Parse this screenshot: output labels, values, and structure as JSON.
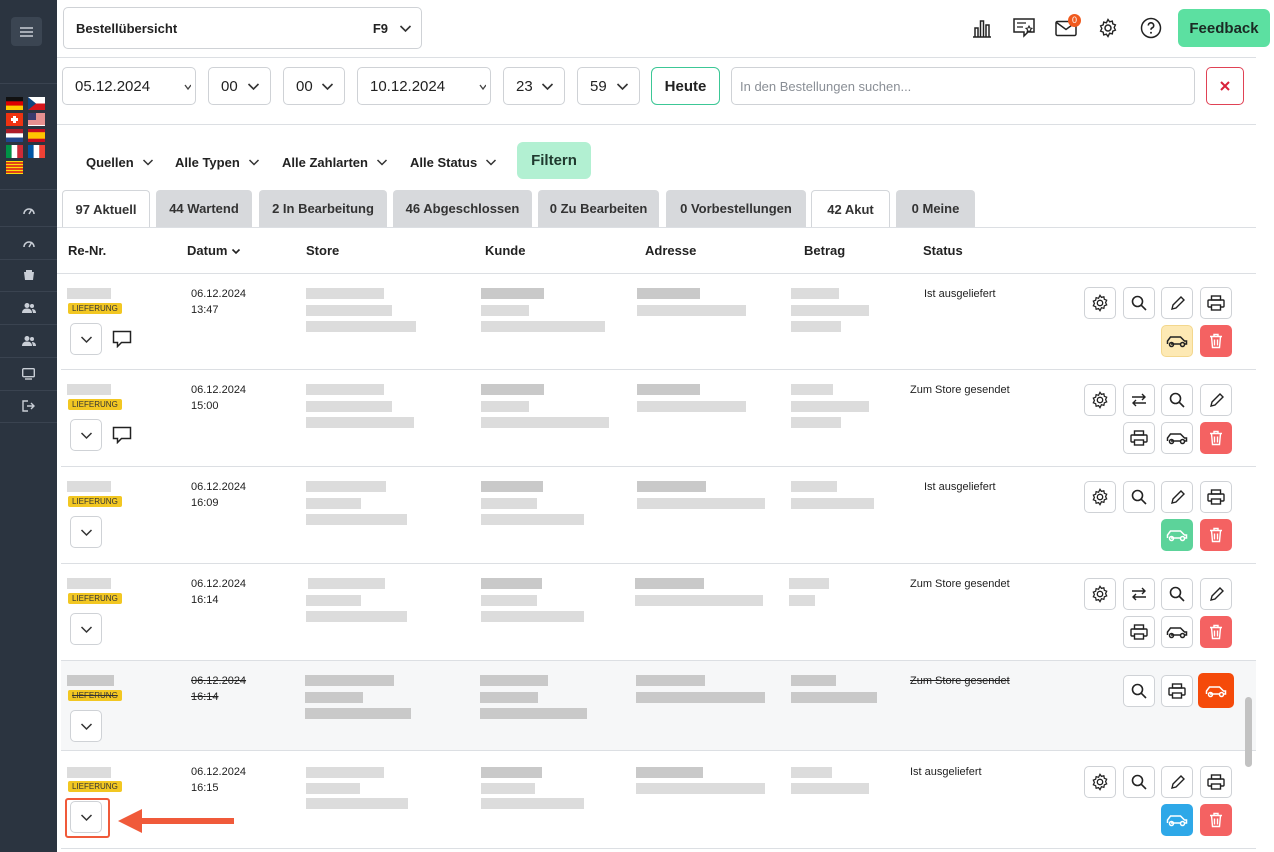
{
  "header": {
    "view_select": {
      "label": "Bestellübersicht",
      "shortcut": "F9"
    },
    "mail_badge": "0",
    "feedback_label": "Feedback"
  },
  "date_filter": {
    "from_date": "05.12.2024",
    "from_hour": "00",
    "from_minute": "00",
    "to_date": "10.12.2024",
    "to_hour": "23",
    "to_minute": "59",
    "today_label": "Heute",
    "search_placeholder": "In den Bestellungen suchen..."
  },
  "filters": {
    "sources": "Quellen",
    "types": "Alle Typen",
    "payment": "Alle Zahlarten",
    "status": "Alle Status",
    "apply_label": "Filtern"
  },
  "tabs": [
    {
      "label": "97 Aktuell",
      "active": true
    },
    {
      "label": "44 Wartend"
    },
    {
      "label": "2 In Bearbeitung"
    },
    {
      "label": "46 Abgeschlossen"
    },
    {
      "label": "0 Zu Bearbeiten"
    },
    {
      "label": "0 Vorbestellungen"
    },
    {
      "label": "42 Akut",
      "active": true
    },
    {
      "label": "0 Meine"
    }
  ],
  "columns": [
    "Re-Nr.",
    "Datum",
    "Store",
    "Kunde",
    "Adresse",
    "Betrag",
    "Status"
  ],
  "orders": [
    {
      "type": "LIEFERUNG",
      "date": "06.12.2024",
      "time": "13:47",
      "status": "Ist ausgeliefert"
    },
    {
      "type": "LIEFERUNG",
      "date": "06.12.2024",
      "time": "15:00",
      "status": "Zum Store gesendet"
    },
    {
      "type": "LIEFERUNG",
      "date": "06.12.2024",
      "time": "16:09",
      "status": "Ist ausgeliefert"
    },
    {
      "type": "LIEFERUNG",
      "date": "06.12.2024",
      "time": "16:14",
      "status": "Zum Store gesendet"
    },
    {
      "type": "LIEFERUNG",
      "date": "06.12.2024",
      "time": "16:14",
      "status": "Zum Store gesendet",
      "cancelled": true
    },
    {
      "type": "LIEFERUNG",
      "date": "06.12.2024",
      "time": "16:15",
      "status": "Ist ausgeliefert"
    }
  ],
  "colors": {
    "sidebar": "#2b3440",
    "accent_green": "#5ce0a1",
    "danger_red": "#f46262",
    "highlight": "#f05a3a",
    "label_yellow": "#f2c722"
  }
}
